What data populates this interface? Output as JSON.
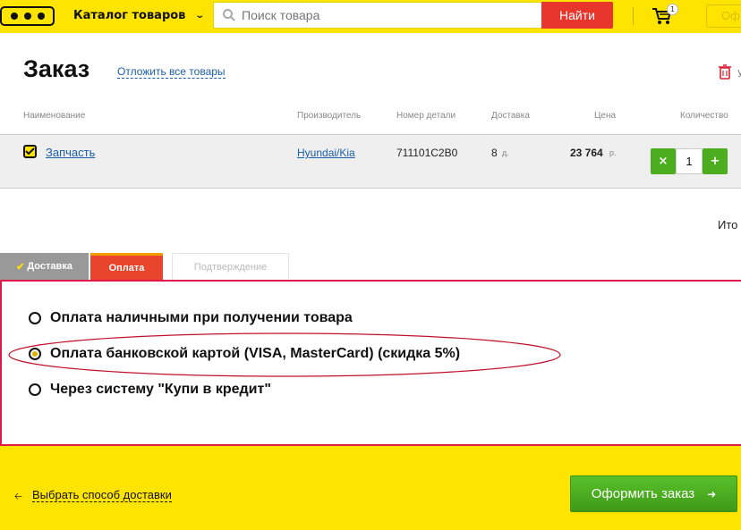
{
  "header": {
    "catalog_label": "Каталог товаров",
    "search_placeholder": "Поиск товара",
    "find_button": "Найти",
    "cart_count": "1",
    "order_button_partial": "Оф"
  },
  "order": {
    "title": "Заказ",
    "defer_link": "Отложить все товары",
    "delete_partial": "У"
  },
  "table": {
    "headers": {
      "name": "Наименование",
      "manufacturer": "Производитель",
      "part_number": "Номер детали",
      "delivery": "Доставка",
      "price": "Цена",
      "quantity": "Количество"
    },
    "rows": [
      {
        "name": "Запчасть",
        "manufacturer": "Hyundai/Kia",
        "part_number": "711101C2B0",
        "delivery_days": "8",
        "delivery_unit": "д.",
        "price": "23 764",
        "price_unit": "р.",
        "quantity": "1",
        "minus": "×",
        "plus": "+"
      }
    ]
  },
  "total_label_partial": "Ито",
  "tabs": {
    "delivery": "Доставка",
    "payment": "Оплата",
    "confirm": "Подтверждение"
  },
  "payment_options": [
    {
      "label": "Оплата наличными при получении товара",
      "selected": false
    },
    {
      "label": "Оплата банковской картой (VISA, MasterCard) (скидка 5%)",
      "selected": true
    },
    {
      "label": "Через систему \"Купи в кредит\"",
      "selected": false
    }
  ],
  "footer": {
    "back_link": "Выбрать способ доставки",
    "submit_button": "Оформить заказ"
  },
  "colors": {
    "brand_yellow": "#ffe400",
    "accent_red": "#e8362c",
    "panel_border": "#e0184c",
    "green": "#4cae1e",
    "link_blue": "#1a5ea8"
  }
}
